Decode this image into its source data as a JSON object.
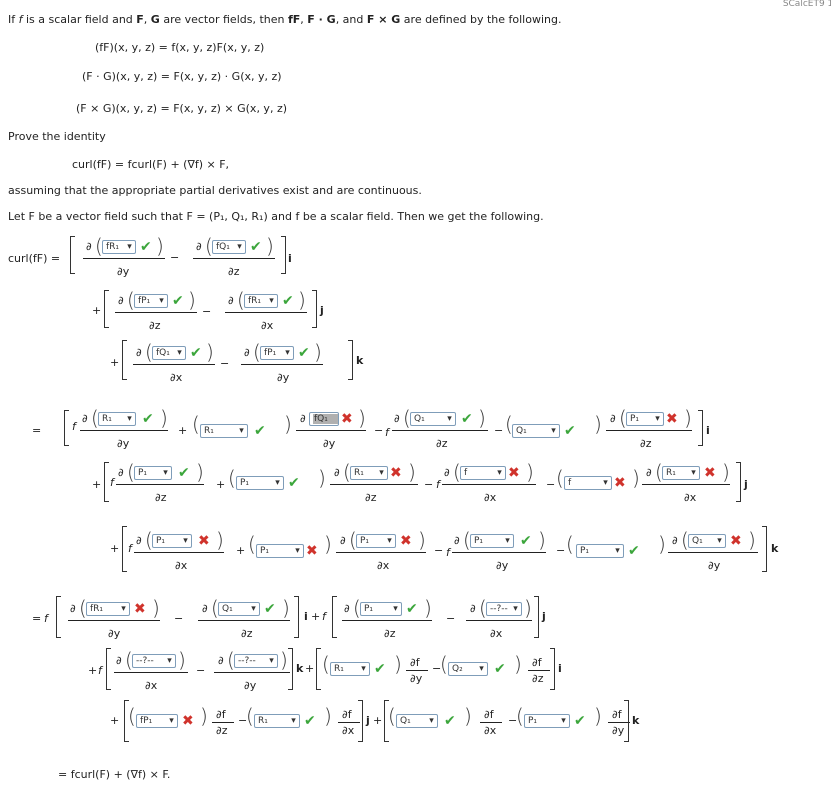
{
  "corner_label": "SCalcET9 16",
  "intro": {
    "text1": "If ",
    "f": "f",
    "text2": " is a scalar field and ",
    "F": "F",
    "text3": ", ",
    "G": "G",
    "text4": " are vector fields, then ",
    "fF": "fF",
    "text5": ", ",
    "FdotG": "F · G",
    "text6": ", and ",
    "FxG": "F × G",
    "text7": " are defined by the following."
  },
  "defs": [
    "(fF)(x, y, z)  =  f(x, y, z)F(x, y, z)",
    "(F · G)(x, y, z)  =  F(x, y, z) · G(x, y, z)",
    "(F × G)(x, y, z)  =  F(x, y, z) × G(x, y, z)"
  ],
  "prove": "Prove the identity",
  "identity": "curl(fF)  =  fcurl(F) + (∇f) × F,",
  "assuming": "assuming that the appropriate partial derivatives exist and are continuous.",
  "let_line": "Let F be a vector field such that F = (P₁, Q₁, R₁)  and f be a scalar field. Then we get the following.",
  "symbols": {
    "curl_lhs": "curl(fF)  =",
    "d": "∂",
    "dy": "∂y",
    "dz": "∂z",
    "dx": "∂x",
    "minus": "−",
    "plus": "+",
    "equals": "=",
    "f": "f",
    "i": "i",
    "j": "j",
    "k": "k",
    "df": "∂f",
    "ok": "✔",
    "bad": "✖",
    "chev": "⌄",
    "final": "=  fcurl(F) + (∇f) × F."
  },
  "selects": {
    "s1": "fR₁",
    "s2": "fQ₁",
    "s3": "fP₁",
    "s4": "fR₁",
    "s5": "fQ₁",
    "s6": "fP₁",
    "t1": "R₁",
    "t2": "R₁",
    "t3": "fQ₁",
    "t4": "Q₁",
    "t5": "Q₁",
    "t6": "P₁",
    "u1": "P₁",
    "u2": "P₁",
    "u3": "R₁",
    "u4": "f",
    "u5": "f",
    "u6": "R₁",
    "v1": "P₁",
    "v2": "P₁",
    "v3": "P₁",
    "v4": "P₁",
    "v5": "P₁",
    "v6": "Q₁",
    "w1": "fR₁",
    "w2": "Q₁",
    "w3": "P₁",
    "w4": "--?--",
    "x1": "--?--",
    "x2": "--?--",
    "x3": "R₁",
    "x4": "Q₂",
    "y1": "fP₁",
    "y2": "R₁",
    "y3": "Q₁",
    "y4": "P₁"
  }
}
